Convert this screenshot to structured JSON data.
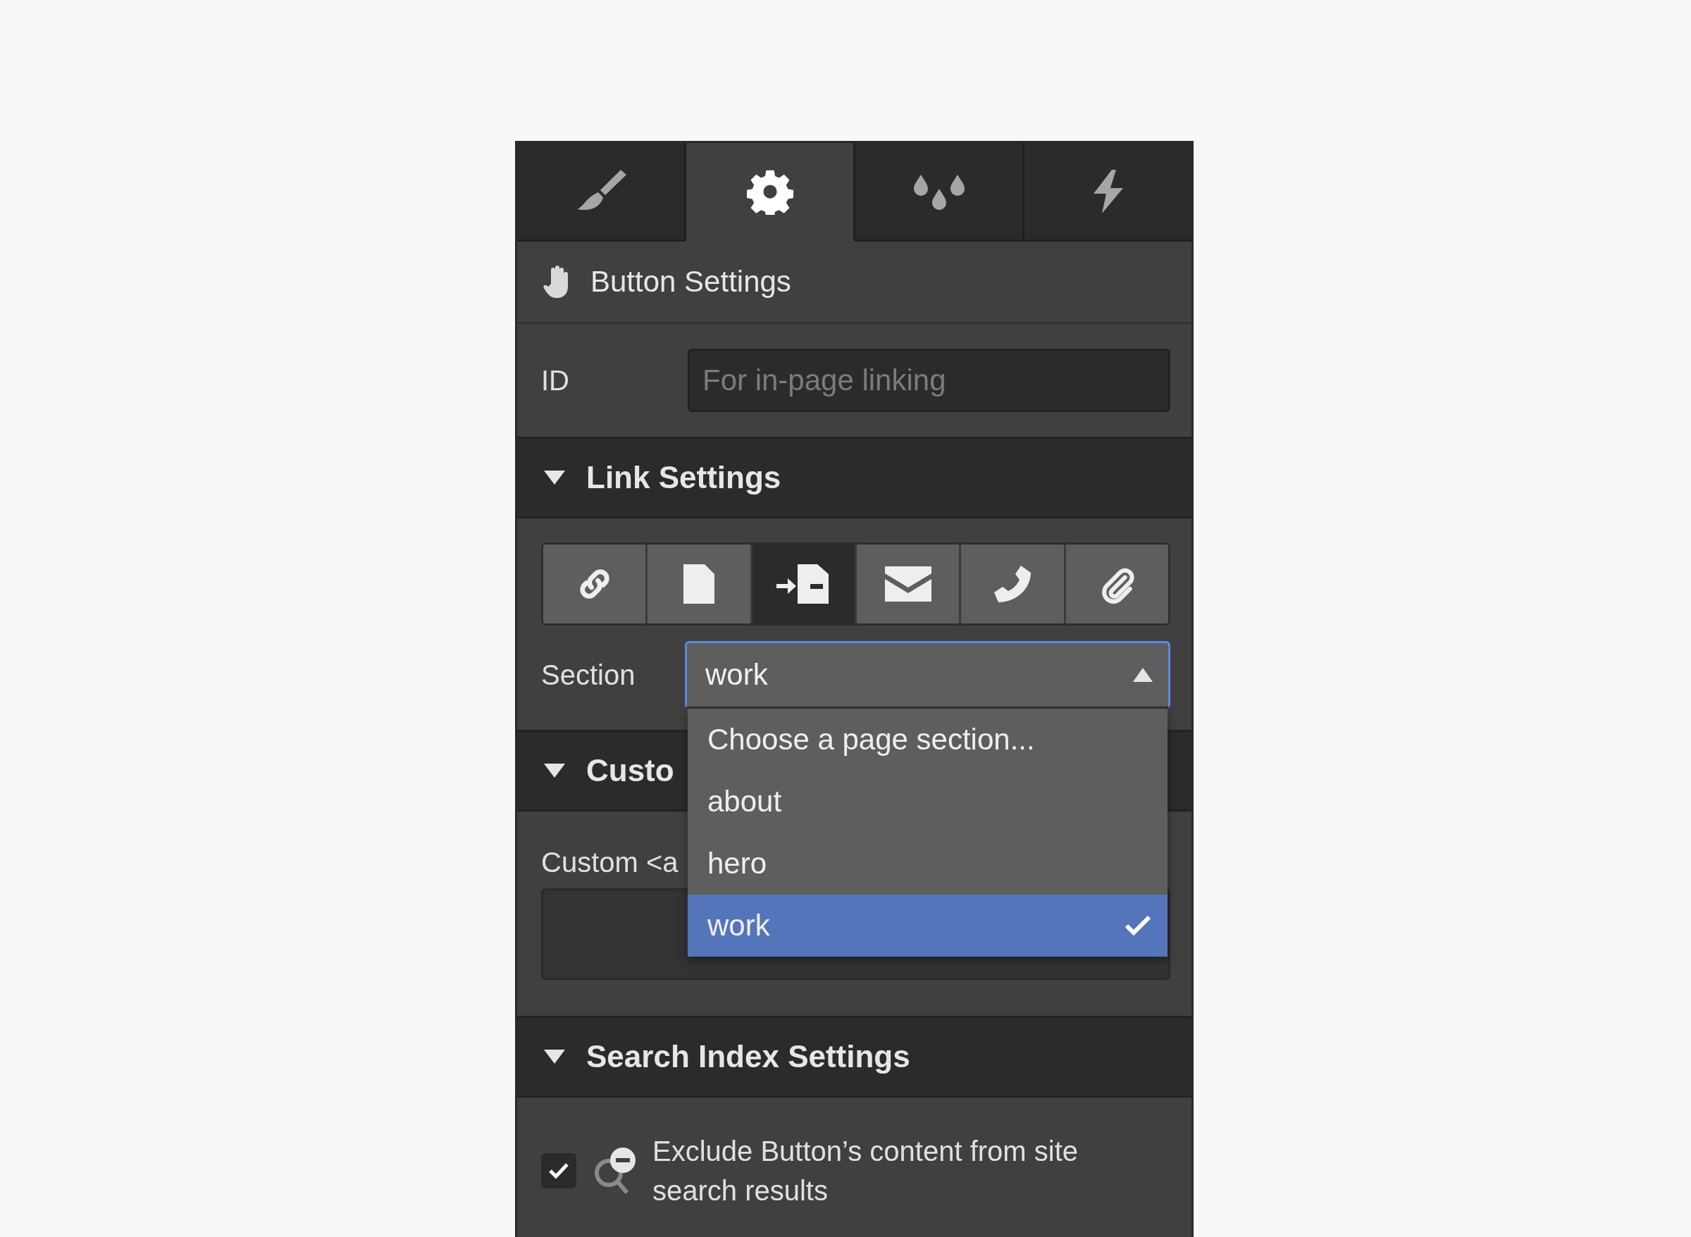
{
  "tabs": [
    {
      "kind": "style",
      "selected": false
    },
    {
      "kind": "settings",
      "selected": true
    },
    {
      "kind": "swatches",
      "selected": false
    },
    {
      "kind": "interactions",
      "selected": false
    }
  ],
  "element_header": {
    "title": "Button Settings"
  },
  "id_field": {
    "label": "ID",
    "placeholder": "For in-page linking"
  },
  "link_settings": {
    "title": "Link Settings",
    "expanded": true,
    "link_types": [
      {
        "kind": "url",
        "selected": false
      },
      {
        "kind": "page",
        "selected": false
      },
      {
        "kind": "section",
        "selected": true
      },
      {
        "kind": "email",
        "selected": false
      },
      {
        "kind": "phone",
        "selected": false
      },
      {
        "kind": "file",
        "selected": false
      }
    ],
    "section": {
      "label": "Section",
      "value": "work",
      "open": true,
      "options": [
        {
          "label": "Choose a page section...",
          "selected": false
        },
        {
          "label": "about",
          "selected": false
        },
        {
          "label": "hero",
          "selected": false
        },
        {
          "label": "work",
          "selected": true
        }
      ]
    }
  },
  "custom_attributes": {
    "title": "Custo",
    "expanded": true,
    "label": "Custom <a"
  },
  "search_index": {
    "title": "Search Index Settings",
    "expanded": true,
    "exclude": {
      "checked": true,
      "label": "Exclude Button’s content from site search results"
    }
  }
}
